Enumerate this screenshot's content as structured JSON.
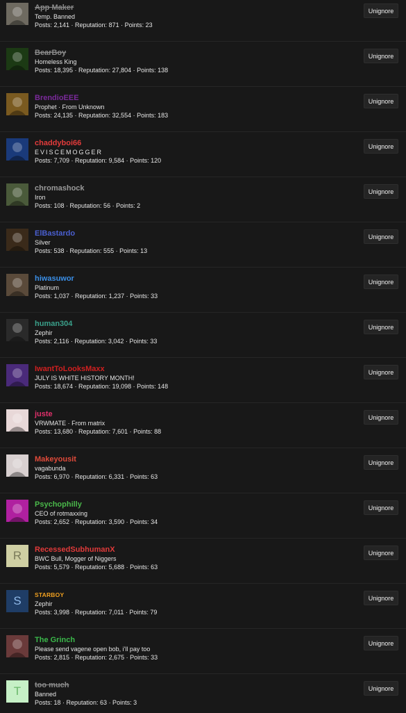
{
  "unignore_label": "Unignore",
  "users": [
    {
      "name": "App Maker",
      "color": "#8a8a8a",
      "banned": true,
      "title": "Temp. Banned",
      "stats": "Posts: 2,141 · Reputation: 871 · Points: 23",
      "avatar": {
        "type": "image",
        "bg": "#6e6a60",
        "icon": "robot-avatar-icon"
      }
    },
    {
      "name": "BearBoy",
      "color": "#8a8a8a",
      "banned": true,
      "title": "Homeless King",
      "stats": "Posts: 18,395 · Reputation: 27,804 · Points: 138",
      "avatar": {
        "type": "image",
        "bg": "#1c3a14",
        "icon": "green-creature-avatar-icon"
      }
    },
    {
      "name": "BrendioEEE",
      "color": "#7a2a9a",
      "banned": false,
      "title": "Prophet · From Unknown",
      "stats": "Posts: 24,135 · Reputation: 32,554 · Points: 183",
      "avatar": {
        "type": "image",
        "bg": "#7a5a20",
        "icon": "cartoon-avatar-icon"
      }
    },
    {
      "name": "chaddyboi66",
      "color": "#e23b3b",
      "banned": false,
      "title": "EVISCEMOGGER",
      "title_spaced": true,
      "stats": "Posts: 7,709 · Reputation: 9,584 · Points: 120",
      "avatar": {
        "type": "image",
        "bg": "#1a3a7a",
        "icon": "sunglasses-avatar-icon"
      }
    },
    {
      "name": "chromashock",
      "color": "#9a9a9a",
      "banned": false,
      "title": "Iron",
      "stats": "Posts: 108 · Reputation: 56 · Points: 2",
      "avatar": {
        "type": "image",
        "bg": "#4a5a3a",
        "icon": "frog-avatar-icon"
      }
    },
    {
      "name": "ElBastardo",
      "color": "#4a5fd0",
      "banned": false,
      "title": "Silver",
      "stats": "Posts: 538 · Reputation: 555 · Points: 13",
      "avatar": {
        "type": "image",
        "bg": "#3a2a1a",
        "icon": "man-avatar-icon"
      }
    },
    {
      "name": "hiwasuwor",
      "color": "#3a8ee6",
      "banned": false,
      "title": "Platinum",
      "stats": "Posts: 1,037 · Reputation: 1,237 · Points: 33",
      "avatar": {
        "type": "image",
        "bg": "#5a4a3a",
        "icon": "face-avatar-icon"
      }
    },
    {
      "name": "human304",
      "color": "#3aa08a",
      "banned": false,
      "title": "Zephir",
      "stats": "Posts: 2,116 · Reputation: 3,042 · Points: 33",
      "avatar": {
        "type": "image",
        "bg": "#2a2a2a",
        "icon": "face-avatar-icon"
      }
    },
    {
      "name": "IwantToLooksMaxx",
      "color": "#d02020",
      "banned": false,
      "title": "JULY IS WHITE HISTORY MONTH!",
      "stats": "Posts: 18,674 · Reputation: 19,098 · Points: 148",
      "avatar": {
        "type": "image",
        "bg": "#4a2a7a",
        "icon": "group-avatar-icon"
      }
    },
    {
      "name": "juste",
      "color": "#e0306a",
      "banned": false,
      "title": "VRWMATE · From matrix",
      "stats": "Posts: 13,680 · Reputation: 7,601 · Points: 88",
      "avatar": {
        "type": "image",
        "bg": "#e8d8d8",
        "icon": "anime-avatar-icon"
      }
    },
    {
      "name": "Makeyousit",
      "color": "#e04a3a",
      "banned": false,
      "title": "vagabunda",
      "stats": "Posts: 6,970 · Reputation: 6,331 · Points: 63",
      "avatar": {
        "type": "image",
        "bg": "#d8d0d0",
        "icon": "collage-avatar-icon"
      }
    },
    {
      "name": "Psychophilly",
      "color": "#4ab84a",
      "banned": false,
      "title": "CEO of rotmaxxing",
      "stats": "Posts: 2,652 · Reputation: 3,590 · Points: 34",
      "avatar": {
        "type": "image",
        "bg": "#b020a0",
        "icon": "burst-avatar-icon"
      }
    },
    {
      "name": "RecessedSubhumanX",
      "color": "#e03a3a",
      "banned": false,
      "title": "BWC Bull, Mogger of Niggers",
      "stats": "Posts: 5,579 · Reputation: 5,688 · Points: 63",
      "avatar": {
        "type": "letter",
        "letter": "R",
        "bg": "#cfcfa3",
        "fg": "#7a7a5a"
      }
    },
    {
      "name": "STARBOY",
      "color": "#f0a020",
      "banned": false,
      "small": true,
      "title": "Zephir",
      "stats": "Posts: 3,998 · Reputation: 7,011 · Points: 79",
      "avatar": {
        "type": "letter",
        "letter": "S",
        "bg": "#1f3d66",
        "fg": "#8fb8e8"
      }
    },
    {
      "name": "The Grinch",
      "color": "#3ab84a",
      "banned": false,
      "title": "Please send vagene open bob, i'll pay too",
      "stats": "Posts: 2,815 · Reputation: 2,675 · Points: 33",
      "avatar": {
        "type": "image",
        "bg": "#6a3a3a",
        "icon": "muscle-avatar-icon"
      }
    },
    {
      "name": "too much",
      "color": "#8a8a8a",
      "banned": true,
      "title": "Banned",
      "stats": "Posts: 18 · Reputation: 63 · Points: 3",
      "avatar": {
        "type": "letter",
        "letter": "T",
        "bg": "#c6f0c6",
        "fg": "#6ab86a"
      }
    }
  ]
}
